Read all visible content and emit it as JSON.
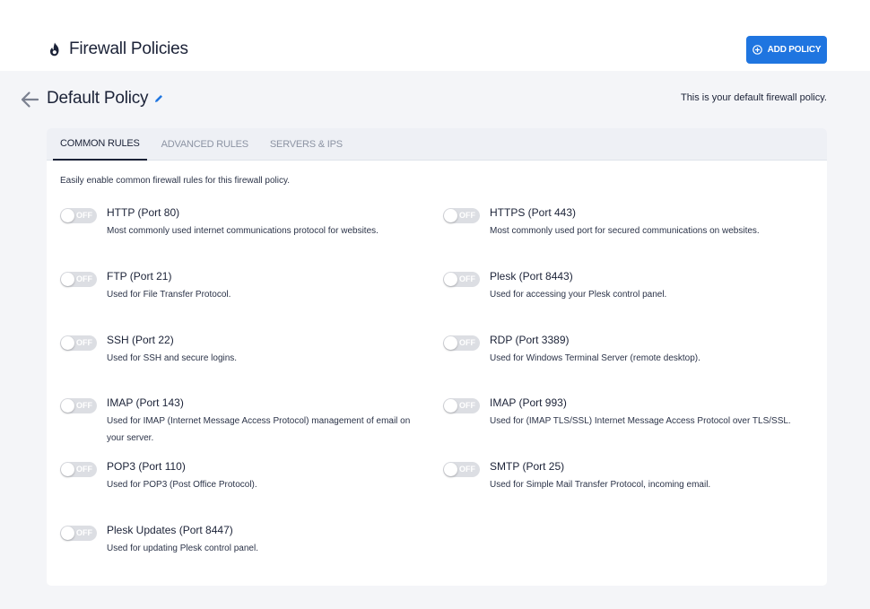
{
  "header": {
    "title": "Firewall Policies",
    "add_button_label": "ADD POLICY"
  },
  "policy": {
    "title": "Default Policy",
    "description": "This is your default firewall policy."
  },
  "tabs": [
    {
      "label": "COMMON RULES",
      "active": true
    },
    {
      "label": "ADVANCED RULES",
      "active": false
    },
    {
      "label": "SERVERS & IPS",
      "active": false
    }
  ],
  "intro": "Easily enable common firewall rules for this firewall policy.",
  "toggle_off_label": "OFF",
  "rules": [
    {
      "name": "HTTP (Port 80)",
      "desc": "Most commonly used internet communications protocol for websites.",
      "enabled": false
    },
    {
      "name": "HTTPS (Port 443)",
      "desc": "Most commonly used port for secured communications on websites.",
      "enabled": false
    },
    {
      "name": "FTP (Port 21)",
      "desc": "Used for File Transfer Protocol.",
      "enabled": false
    },
    {
      "name": "Plesk (Port 8443)",
      "desc": "Used for accessing your Plesk control panel.",
      "enabled": false
    },
    {
      "name": "SSH (Port 22)",
      "desc": "Used for SSH and secure logins.",
      "enabled": false
    },
    {
      "name": "RDP (Port 3389)",
      "desc": "Used for Windows Terminal Server (remote desktop).",
      "enabled": false
    },
    {
      "name": "IMAP (Port 143)",
      "desc": "Used for IMAP (Internet Message Access Protocol) management of email on your server.",
      "enabled": false
    },
    {
      "name": "IMAP (Port 993)",
      "desc": "Used for (IMAP TLS/SSL) Internet Message Access Protocol over TLS/SSL.",
      "enabled": false
    },
    {
      "name": "POP3 (Port 110)",
      "desc": "Used for POP3 (Post Office Protocol).",
      "enabled": false
    },
    {
      "name": "SMTP (Port 25)",
      "desc": "Used for Simple Mail Transfer Protocol, incoming email.",
      "enabled": false
    },
    {
      "name": "Plesk Updates (Port 8447)",
      "desc": "Used for updating Plesk control panel.",
      "enabled": false
    }
  ],
  "colors": {
    "accent": "#1f75e0",
    "text": "#1b2237",
    "toggle_off": "#dcdee3"
  }
}
